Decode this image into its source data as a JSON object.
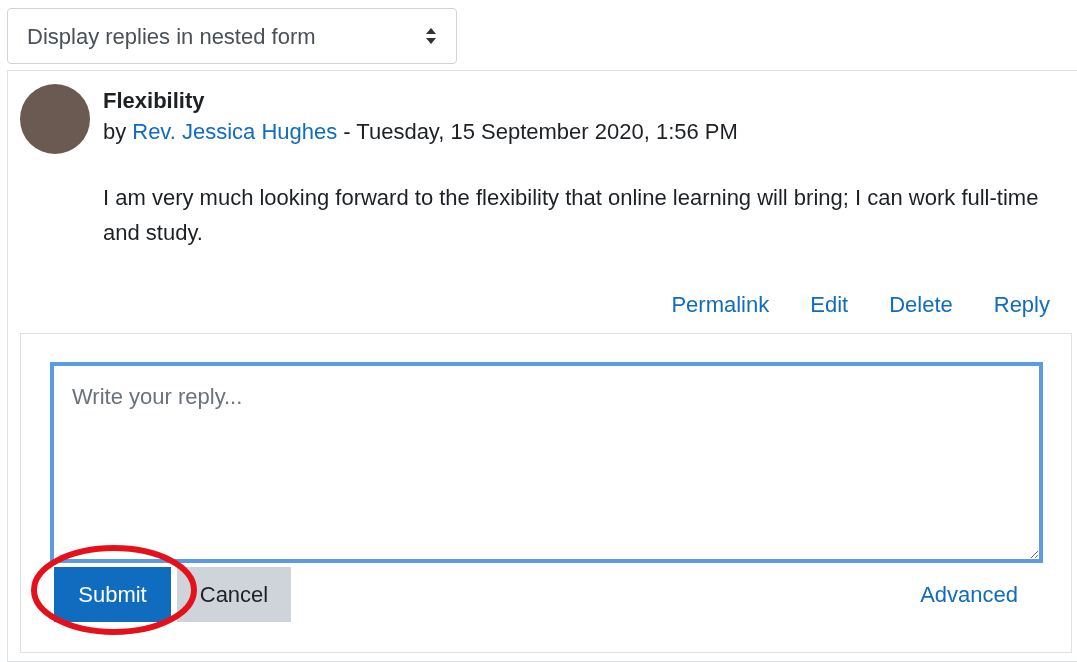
{
  "display_mode": {
    "value": "Display replies in nested form"
  },
  "post": {
    "subject": "Flexibility",
    "by": "by",
    "author": "Rev. Jessica Hughes",
    "date": "- Tuesday, 15 September 2020, 1:56 PM",
    "message": "I am very much looking forward to the flexibility that online learning will bring; I can work full-time and study.",
    "actions": [
      "Permalink",
      "Edit",
      "Delete",
      "Reply"
    ]
  },
  "reply_form": {
    "placeholder": "Write your reply...",
    "submit": "Submit",
    "cancel": "Cancel",
    "advanced": "Advanced",
    "highlight": true
  }
}
